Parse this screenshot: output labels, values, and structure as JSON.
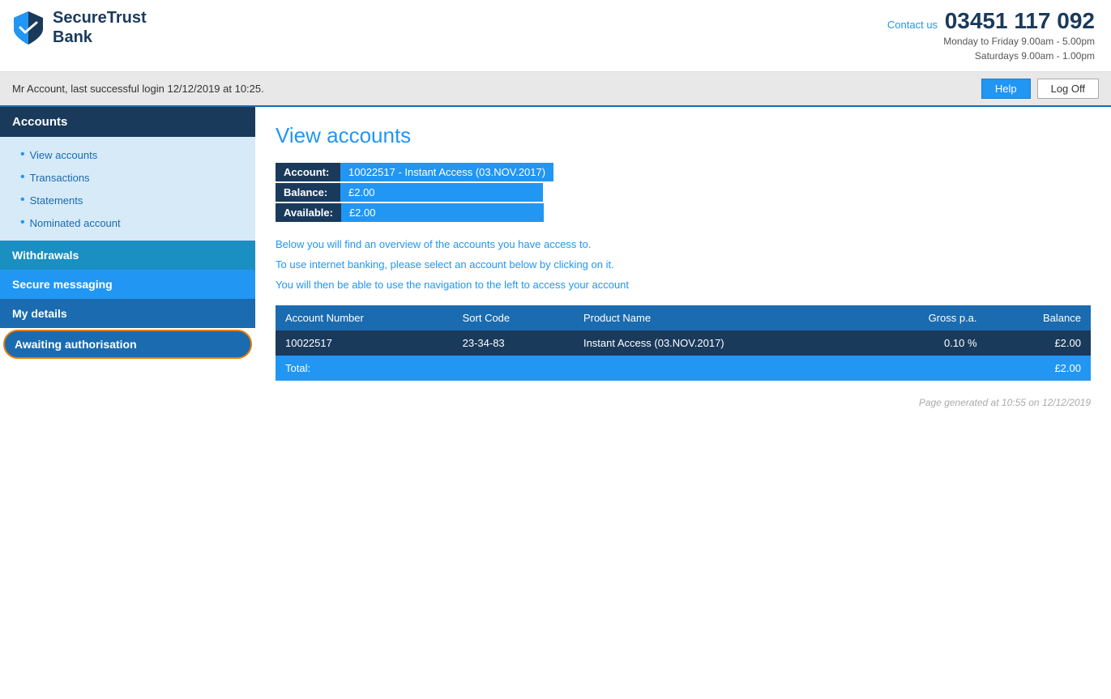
{
  "header": {
    "brand_name_line1": "SecureTrust",
    "brand_name_line2": "Bank",
    "contact_label": "Contact us",
    "phone": "03451 117 092",
    "hours_line1": "Monday to Friday 9.00am - 5.00pm",
    "hours_line2": "Saturdays 9.00am - 1.00pm"
  },
  "topbar": {
    "login_info": "Mr Account, last successful login 12/12/2019 at 10:25.",
    "help_label": "Help",
    "logoff_label": "Log Off"
  },
  "sidebar": {
    "accounts_header": "Accounts",
    "sub_items": [
      {
        "label": "View accounts"
      },
      {
        "label": "Transactions"
      },
      {
        "label": "Statements"
      },
      {
        "label": "Nominated account"
      }
    ],
    "nav_items": [
      {
        "label": "Withdrawals",
        "key": "withdrawals"
      },
      {
        "label": "Secure messaging",
        "key": "secure-messaging"
      },
      {
        "label": "My details",
        "key": "my-details"
      },
      {
        "label": "Awaiting authorisation",
        "key": "awaiting"
      }
    ]
  },
  "content": {
    "page_title": "View accounts",
    "account_label": "Account:",
    "account_value": "10022517 - Instant Access (03.NOV.2017)",
    "balance_label": "Balance:",
    "balance_value": "£2.00",
    "available_label": "Available:",
    "available_value": "£2.00",
    "info_line1": "Below you will find an overview of the accounts you have access to.",
    "info_line2": "To use internet banking, please select an account below by clicking on it.",
    "info_line3": "You will then be able to use the navigation to the left to access your account",
    "table": {
      "headers": [
        "Account Number",
        "Sort Code",
        "Product Name",
        "Gross p.a.",
        "Balance"
      ],
      "rows": [
        {
          "account_number": "10022517",
          "sort_code": "23-34-83",
          "product_name": "Instant Access (03.NOV.2017)",
          "gross_pa": "0.10 %",
          "balance": "£2.00"
        }
      ],
      "footer_label": "Total:",
      "footer_balance": "£2.00"
    },
    "page_generated": "Page generated at 10:55 on 12/12/2019"
  }
}
